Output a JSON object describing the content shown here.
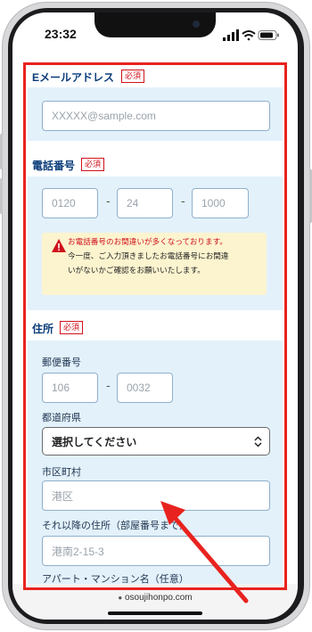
{
  "status_bar": {
    "time": "23:32"
  },
  "email_section": {
    "title": "Eメールアドレス",
    "required_badge": "必須",
    "email_placeholder": "XXXXX@sample.com"
  },
  "phone_section": {
    "title": "電話番号",
    "required_badge": "必須",
    "part1_placeholder": "0120",
    "part2_placeholder": "24",
    "part3_placeholder": "1000",
    "separator": "-",
    "warning": {
      "line1": "お電話番号のお間違いが多くなっております。",
      "line2": "今一度、ご入力頂きましたお電話番号にお間違",
      "line3": "いがないかご確認をお願いいたします。",
      "heading_color": "#d0121b"
    }
  },
  "address_section": {
    "title": "住所",
    "required_badge": "必須",
    "postal_label": "郵便番号",
    "postal1_placeholder": "106",
    "postal2_placeholder": "0032",
    "separator": "-",
    "prefecture_label": "都道府県",
    "prefecture_selected": "選択してください",
    "city_label": "市区町村",
    "city_placeholder": "港区",
    "street_label": "それ以降の住所（部屋番号まで）",
    "street_placeholder": "港南2-15-3",
    "building_label": "アパート・マンション名（任意）"
  },
  "browser": {
    "url": "osoujihonpo.com"
  },
  "colors": {
    "highlight_frame": "#e8231f",
    "annotation_arrow": "#e8231f",
    "section_title": "#0b3d7a",
    "section_bg": "#e3f1fb"
  }
}
